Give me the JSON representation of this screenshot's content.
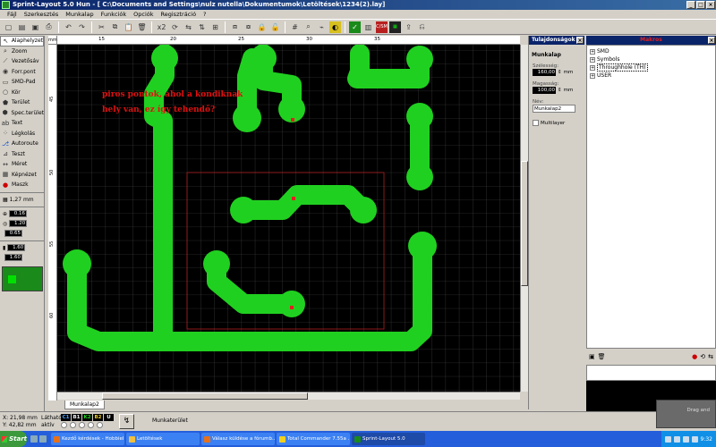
{
  "window": {
    "title": "Sprint-Layout 5.0 Hun  - [ C:\\Documents and Settings\\nulz nutella\\Dokumentumok\\Letöltések\\1234(2).lay]",
    "controls": [
      "_",
      "□",
      "×"
    ]
  },
  "menu": [
    "Fájl",
    "Szerkesztés",
    "Munkalap",
    "Funkciók",
    "Opciók",
    "Regisztráció",
    "?"
  ],
  "toolbar": {
    "zoom_label": "x2",
    "layer_badge": "C/SM"
  },
  "tools": [
    {
      "label": "Alaphelyzet",
      "icon": "arrow-icon",
      "glyph": "↖"
    },
    {
      "label": "Zoom",
      "icon": "zoom-icon",
      "glyph": "⌕"
    },
    {
      "label": "Vezetősáv",
      "icon": "track-icon",
      "glyph": "⟋"
    },
    {
      "label": "Forr.pont",
      "icon": "pad-icon",
      "glyph": "◉"
    },
    {
      "label": "SMD-Pad",
      "icon": "smd-icon",
      "glyph": "▭"
    },
    {
      "label": "Kör",
      "icon": "circle-icon",
      "glyph": "○"
    },
    {
      "label": "Terület",
      "icon": "area-icon",
      "glyph": "⬟"
    },
    {
      "label": "Spec.terület",
      "icon": "special-area-icon",
      "glyph": "⬢"
    },
    {
      "label": "Text",
      "icon": "text-icon",
      "glyph": "ab"
    },
    {
      "label": "Légkolás",
      "icon": "via-icon",
      "glyph": "⁘"
    },
    {
      "label": "Autoroute",
      "icon": "autoroute-icon",
      "glyph": "⎇"
    },
    {
      "label": "Teszt",
      "icon": "test-icon",
      "glyph": "⊿"
    },
    {
      "label": "Méret",
      "icon": "measure-icon",
      "glyph": "↔"
    },
    {
      "label": "Képnézet",
      "icon": "photo-icon",
      "glyph": "▦"
    },
    {
      "label": "Maszk",
      "icon": "mask-icon",
      "glyph": "●"
    }
  ],
  "sizes": {
    "grid": "1,27 mm",
    "pad_outer": "0.16",
    "pad_inner1": "1.20",
    "pad_inner2": "0.65",
    "smd_w": "1.60",
    "smd_h": "1.60"
  },
  "ruler": {
    "unit": "mm",
    "top": [
      "15",
      "20",
      "25",
      "30",
      "35"
    ],
    "left": [
      "45",
      "50",
      "55",
      "60"
    ]
  },
  "canvas": {
    "annotation_line1": "piros pontok, ahol a kondiknak",
    "annotation_line2": "hely van, ez így tehendő?"
  },
  "sheet_tab": "Munkalap2",
  "properties": {
    "header": "Tulajdonságok",
    "section": "Munkalap",
    "width_label": "Szélesség:",
    "width_value": "160,00",
    "height_label": "Magasság:",
    "height_value": "100,00",
    "unit": "mm",
    "name_label": "Név:",
    "name_value": "Munkalap2",
    "multilayer_label": "Multilayer"
  },
  "macros": {
    "header": "Makros",
    "items": [
      "SMD",
      "Symbols",
      "Throughhole (TH)",
      "USER"
    ]
  },
  "status": {
    "x": "X:  21,98 mm",
    "y": "Y:  42,82 mm",
    "visible_label": "Látható",
    "active_label": "aktív",
    "layers": [
      {
        "name": "C1",
        "color": "#4a9cff"
      },
      {
        "name": "B1",
        "color": "#f0f0f0"
      },
      {
        "name": "K2",
        "color": "#20d020"
      },
      {
        "name": "B2",
        "color": "#f0d020"
      },
      {
        "name": "U",
        "color": "#f0f0f0"
      }
    ],
    "work_area_label": "Munkaterület",
    "float_title": "Drag and"
  },
  "taskbar": {
    "start": "Start",
    "tasks": [
      {
        "label": "Kezdő kérdések - Hobbiel...",
        "color": "#e8701a"
      },
      {
        "label": "Letöltések",
        "color": "#f0c040"
      },
      {
        "label": "Válasz küldése a fórumb...",
        "color": "#e8701a"
      },
      {
        "label": "Total Commander 7.55a ...",
        "color": "#f0d020"
      },
      {
        "label": "Sprint-Layout 5.0",
        "color": "#1a8a1a"
      }
    ],
    "clock": "9:32"
  }
}
